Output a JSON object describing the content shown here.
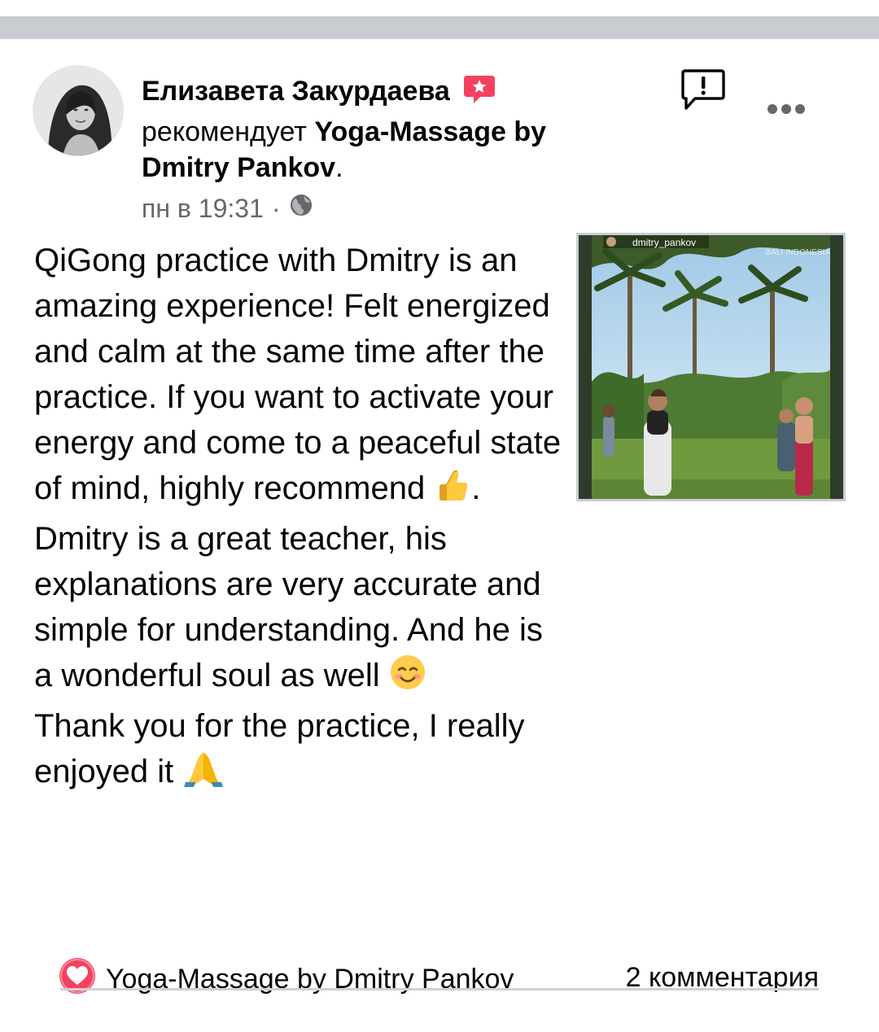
{
  "post": {
    "author_name": "Елизавета Закурдаева",
    "recommend_verb": "рекомендует",
    "page_name": "Yoga-Massage by Dmitry Pankov",
    "page_suffix": ".",
    "timestamp": "пн в 19:31",
    "separator": "·",
    "icons": {
      "badge": "recommend-badge-icon",
      "report": "report-icon",
      "more": "more-options-icon",
      "audience": "globe-icon"
    },
    "body_paragraphs": [
      "QiGong practice with Dmitry is an amazing experience! Felt energized and calm at the same time after the practice. If you want to activate your energy and come to a peaceful state of mind, highly recommend",
      ".",
      "Dmitry is a great teacher, his explanations are very accurate and simple for understanding. And he is a wonderful soul as well",
      "Thank you for the practice, I really enjoyed it"
    ],
    "emojis": [
      "👍",
      "☺️",
      "🙏"
    ],
    "photo": {
      "watermark_user": "dmitry_pankov",
      "watermark_location": "BALI INDONESIA"
    }
  },
  "footer": {
    "page_name": "Yoga-Massage by Dmitry Pankov",
    "comments": "2 комментария"
  },
  "colors": {
    "text": "#050505",
    "meta": "#65676b",
    "badge": "#f3425f",
    "divider": "#c9ccd1"
  }
}
